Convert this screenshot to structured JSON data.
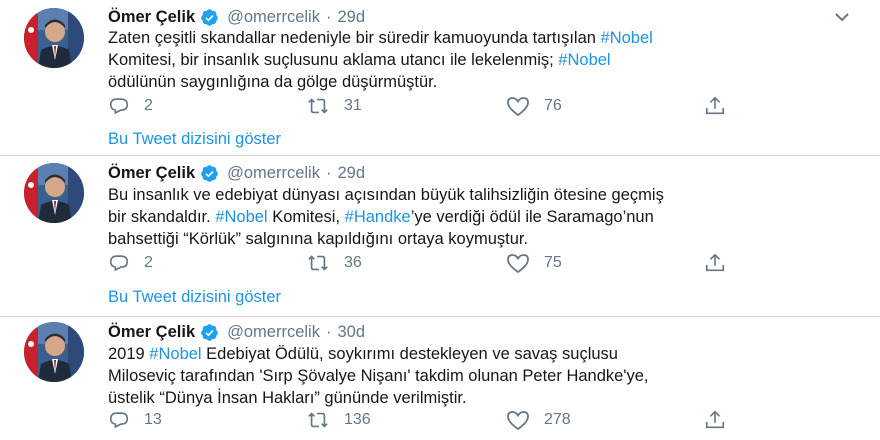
{
  "colors": {
    "link": "#1b95e0",
    "muted": "#657786",
    "text": "#14171a",
    "verified": "#1da1f2"
  },
  "tweets": [
    {
      "author": "Ömer Çelik",
      "handle": "@omerrcelik",
      "separator": "·",
      "time": "29d",
      "lines": [
        [
          "Zaten çeşitli skandallar nedeniyle bir süredir kamuoyunda tartışılan ",
          "#Nobel"
        ],
        [
          " Komitesi, bir insanlık suçlusunu aklama utancı ile lekelenmiş; ",
          "#Nobel"
        ],
        [
          " ödülünün saygınlığına da gölge düşürmüştür."
        ]
      ],
      "replies": "2",
      "retweets": "31",
      "likes": "76",
      "thread_link": "Bu Tweet dizisini göster"
    },
    {
      "author": "Ömer Çelik",
      "handle": "@omerrcelik",
      "separator": "·",
      "time": "29d",
      "lines": [
        [
          "Bu insanlık ve edebiyat dünyası açısından büyük talihsizliğin ötesine geçmiş"
        ],
        [
          "bir skandaldır. ",
          "#Nobel",
          " Komitesi, ",
          "#Handke",
          "’ye verdiği ödül ile Saramago’nun"
        ],
        [
          "bahsettiği “Körlük” salgınına kapıldığını ortaya koymuştur."
        ]
      ],
      "replies": "2",
      "retweets": "36",
      "likes": "75",
      "thread_link": "Bu Tweet dizisini göster"
    },
    {
      "author": "Ömer Çelik",
      "handle": "@omerrcelik",
      "separator": "·",
      "time": "30d",
      "lines": [
        [
          "2019 ",
          "#Nobel",
          " Edebiyat Ödülü, soykırımı destekleyen ve savaş suçlusu"
        ],
        [
          "Miloseviç tarafından 'Sırp Şövalye Nişanı' takdim olunan Peter Handke'ye,"
        ],
        [
          "üstelik “Dünya İnsan Hakları” gününde verilmiştir."
        ]
      ],
      "replies": "13",
      "retweets": "136",
      "likes": "278"
    }
  ],
  "icons": {
    "avatar": "avatar-portrait",
    "verified": "verified-badge-icon",
    "menu": "chevron-down-icon",
    "reply": "reply-icon",
    "retweet": "retweet-icon",
    "like": "heart-icon",
    "share": "share-icon"
  }
}
